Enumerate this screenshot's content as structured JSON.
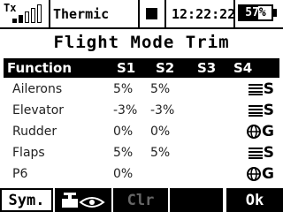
{
  "status": {
    "tx_label": "Tx",
    "model_name": "Thermic",
    "clock": "12:22:22",
    "battery_percent": "57%",
    "battery_level": 0.57,
    "signal_bars_filled": 2
  },
  "page": {
    "title": "Flight Mode Trim"
  },
  "table": {
    "headers": [
      "Function",
      "S1",
      "S2",
      "S3",
      "S4"
    ],
    "rows": [
      {
        "name": "Ailerons",
        "s1": "5%",
        "s2": "5%",
        "mode_icon": "bars-icon",
        "mode_letter": "S"
      },
      {
        "name": "Elevator",
        "s1": "-3%",
        "s2": "-3%",
        "mode_icon": "bars-icon",
        "mode_letter": "S"
      },
      {
        "name": "Rudder",
        "s1": "0%",
        "s2": "0%",
        "mode_icon": "globe-icon",
        "mode_letter": "G"
      },
      {
        "name": "Flaps",
        "s1": "5%",
        "s2": "5%",
        "mode_icon": "bars-icon",
        "mode_letter": "S"
      },
      {
        "name": "P6",
        "s1": "0%",
        "s2": "",
        "mode_icon": "globe-icon",
        "mode_letter": "G"
      }
    ]
  },
  "softkeys": {
    "sym": "Sym.",
    "view_icon": "servo-view-icon",
    "clr": "Clr",
    "ok": "Ok"
  }
}
